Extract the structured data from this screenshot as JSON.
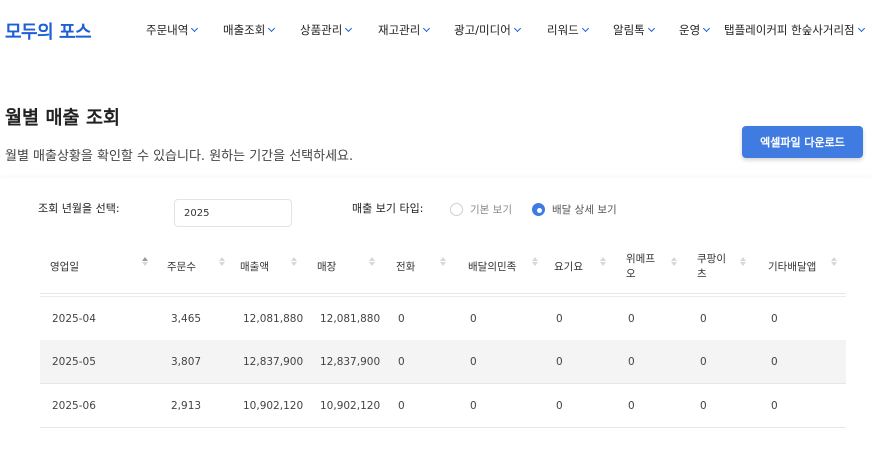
{
  "header": {
    "logo": "모두의 포스",
    "nav": [
      "주문내역",
      "매출조회",
      "상품관리",
      "재고관리",
      "광고/미디어",
      "리워드",
      "알림톡",
      "운영"
    ],
    "store": "탭플레이커피 한숲사거리점"
  },
  "page": {
    "title": "월별 매출 조회",
    "subtitle": "월별 매출상황을 확인할 수 있습니다. 원하는 기간을 선택하세요.",
    "excel_button": "엑셀파일 다운로드"
  },
  "filters": {
    "year_label": "조회 년월을 선택:",
    "year_value": "2025",
    "type_label": "매출 보기 타입:",
    "options": [
      "기본 보기",
      "배달 상세 보기"
    ],
    "selected": "배달 상세 보기"
  },
  "table": {
    "columns": [
      "영업일",
      "주문수",
      "매출액",
      "매장",
      "전화",
      "배달의민족",
      "요기요",
      "위메프\n오",
      "쿠팡이\n츠",
      "기타배달앱"
    ],
    "rows": [
      [
        "2025-04",
        "3,465",
        "12,081,880",
        "12,081,880",
        "0",
        "0",
        "0",
        "0",
        "0",
        "0"
      ],
      [
        "2025-05",
        "3,807",
        "12,837,900",
        "12,837,900",
        "0",
        "0",
        "0",
        "0",
        "0",
        "0"
      ],
      [
        "2025-06",
        "2,913",
        "10,902,120",
        "10,902,120",
        "0",
        "0",
        "0",
        "0",
        "0",
        "0"
      ]
    ]
  },
  "colors": {
    "accent": "#3f7be0",
    "logo": "#1e5fd6",
    "row_alt": "#f4f4f4"
  }
}
